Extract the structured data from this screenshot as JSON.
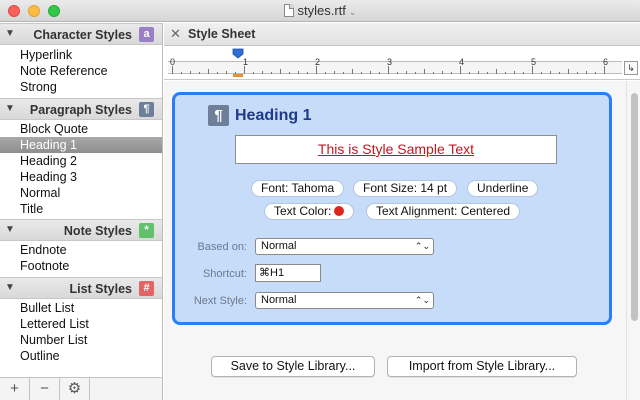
{
  "window": {
    "title": "styles.rtf"
  },
  "sidebar": {
    "sections": [
      {
        "title": "Character Styles",
        "badge": "a",
        "badge_color": "#9a7fc4",
        "items": [
          "Hyperlink",
          "Note Reference",
          "Strong"
        ]
      },
      {
        "title": "Paragraph Styles",
        "badge": "¶",
        "badge_color": "#6d7f99",
        "items": [
          "Block Quote",
          "Heading 1",
          "Heading 2",
          "Heading 3",
          "Normal",
          "Title"
        ],
        "selected_index": 1
      },
      {
        "title": "Note Styles",
        "badge": "*",
        "badge_color": "#63c06b",
        "items": [
          "Endnote",
          "Footnote"
        ]
      },
      {
        "title": "List Styles",
        "badge": "#",
        "badge_color": "#e36464",
        "items": [
          "Bullet List",
          "Lettered List",
          "Number List",
          "Outline"
        ]
      }
    ],
    "bottom": {
      "add": "+",
      "remove": "−",
      "gear": "⚙"
    }
  },
  "main": {
    "header_title": "Style Sheet",
    "ruler": {
      "numbers": [
        "0",
        "1",
        "2",
        "3",
        "4",
        "5",
        "6"
      ]
    },
    "style": {
      "name": "Heading 1",
      "sample_text": "This is Style Sample Text",
      "chips": {
        "font": "Font: Tahoma",
        "font_size": "Font Size: 14 pt",
        "underline": "Underline",
        "text_color": "Text Color:",
        "text_color_value": "#e0261c",
        "alignment": "Text Alignment: Centered"
      },
      "based_on_label": "Based on:",
      "based_on_value": "Normal",
      "shortcut_label": "Shortcut:",
      "shortcut_value": "⌘H1",
      "next_style_label": "Next Style:",
      "next_style_value": "Normal"
    },
    "buttons": {
      "save": "Save to Style Library...",
      "import": "Import from Style Library..."
    }
  }
}
